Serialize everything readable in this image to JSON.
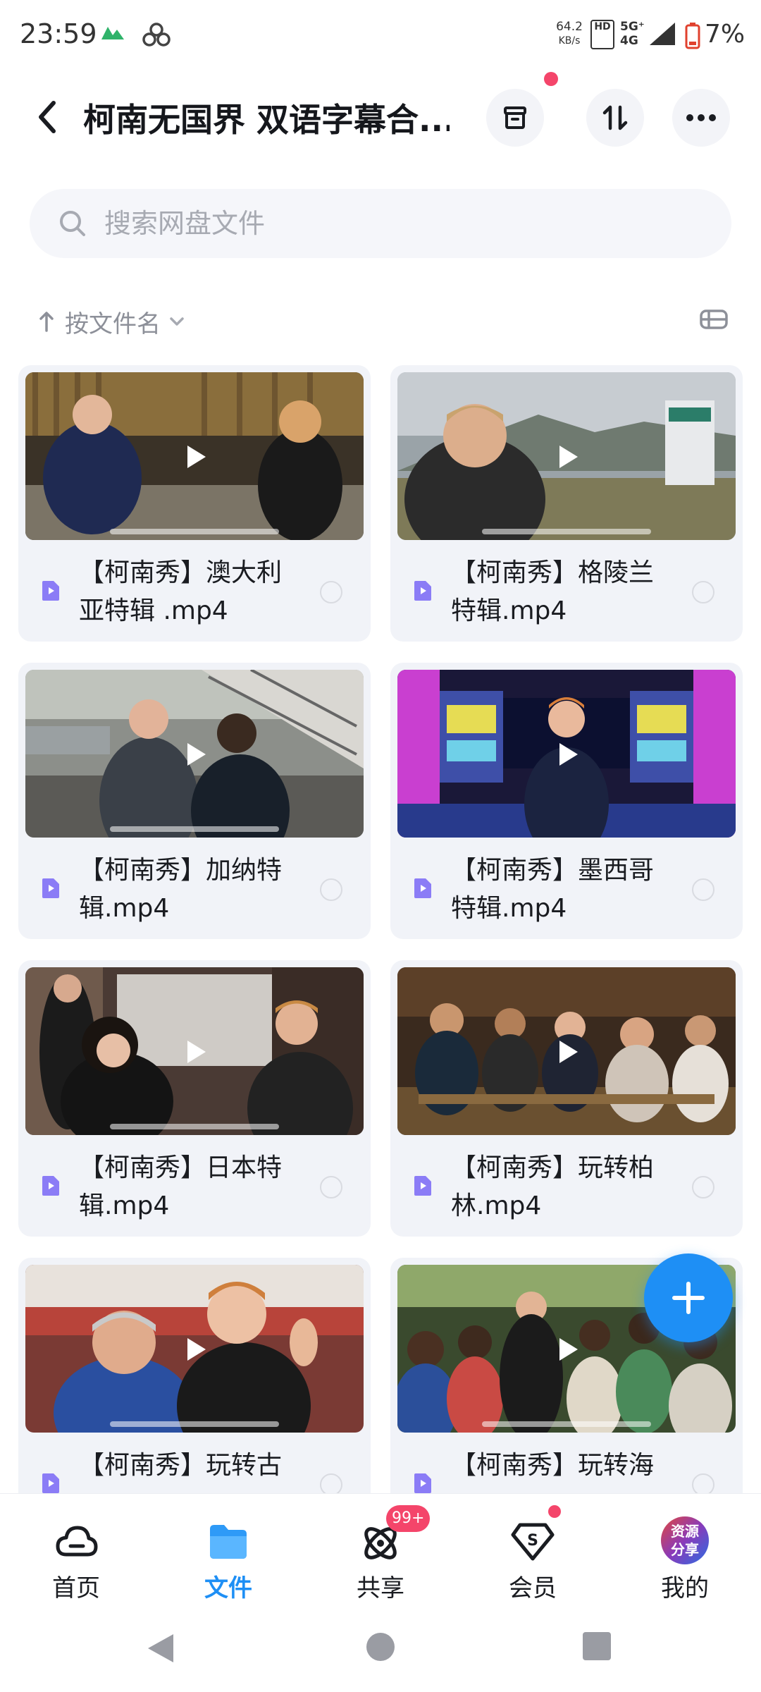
{
  "status_bar": {
    "time": "23:59",
    "speed_value": "64.2",
    "speed_unit": "KB/s",
    "hd_label": "HD",
    "network_top": "5G⁺",
    "network_bottom": "4G",
    "battery": "7%",
    "icons": [
      "mountain-icon",
      "clover-icon",
      "signal-icon",
      "battery-low-icon"
    ]
  },
  "header": {
    "title": "柯南无国界 双语字幕合...",
    "back_icon": "chevron-left-icon",
    "actions": [
      "archive-icon",
      "transfer-arrows-icon",
      "more-icon"
    ]
  },
  "search": {
    "placeholder": "搜索网盘文件",
    "value": ""
  },
  "sort": {
    "label": "按文件名",
    "view_icon": "list-view-icon"
  },
  "files": [
    {
      "name": "【柯南秀】澳大利亚特辑 .mp4"
    },
    {
      "name": "【柯南秀】格陵兰特辑.mp4"
    },
    {
      "name": "【柯南秀】加纳特辑.mp4"
    },
    {
      "name": "【柯南秀】墨西哥特辑.mp4"
    },
    {
      "name": "【柯南秀】日本特辑.mp4"
    },
    {
      "name": "【柯南秀】玩转柏林.mp4"
    },
    {
      "name": "【柯南秀】玩转古"
    },
    {
      "name": "【柯南秀】玩转海"
    }
  ],
  "fab": {
    "icon": "plus-icon"
  },
  "bottom_nav": {
    "items": [
      {
        "label": "首页",
        "icon": "cloud-home-icon"
      },
      {
        "label": "文件",
        "icon": "folder-icon"
      },
      {
        "label": "共享",
        "icon": "share-orbit-icon",
        "badge": "99+"
      },
      {
        "label": "会员",
        "icon": "vip-diamond-icon"
      },
      {
        "label": "我的",
        "icon": "avatar"
      }
    ],
    "avatar_text_1": "资源",
    "avatar_text_2": "分享"
  },
  "colors": {
    "accent": "#1e8ff5",
    "badge": "#f4456a",
    "card_bg": "#f1f3f8",
    "file_icon": "#8b7cf6"
  }
}
